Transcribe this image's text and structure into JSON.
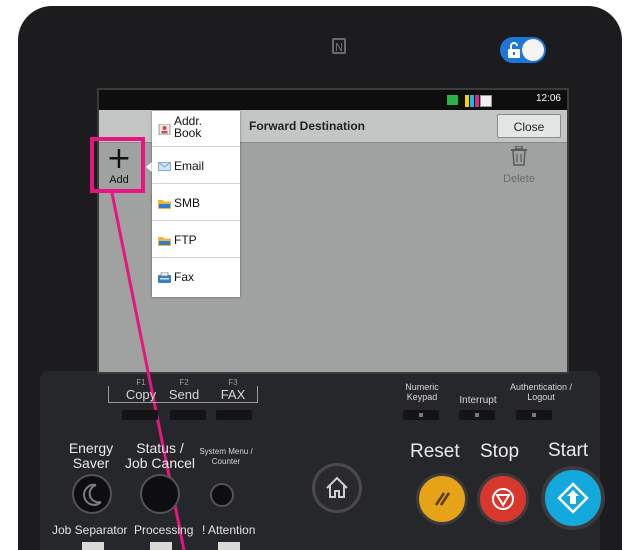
{
  "panel": {
    "nfc_icon": "nfc-icon",
    "lock_icon": "unlock-icon",
    "lock_toggle_color": "#1f76d8"
  },
  "screen": {
    "status": {
      "time": "12:06",
      "toner_colors": [
        "#f5d400",
        "#1eb4e6",
        "#d6278f",
        "#222222"
      ]
    },
    "title": "Forward Destination",
    "close_label": "Close",
    "add_label": "Add",
    "delete_label": "Delete",
    "hidden_fragment": "D",
    "menu": [
      {
        "label": "Addr.\nBook",
        "icon": "address-book-icon"
      },
      {
        "label": "Email",
        "icon": "email-icon"
      },
      {
        "label": "SMB",
        "icon": "smb-folder-icon"
      },
      {
        "label": "FTP",
        "icon": "ftp-folder-icon"
      },
      {
        "label": "Fax",
        "icon": "fax-icon"
      }
    ]
  },
  "function_keys": [
    {
      "num": "F1",
      "label": "Copy"
    },
    {
      "num": "F2",
      "label": "Send"
    },
    {
      "num": "F3",
      "label": "FAX"
    }
  ],
  "right_keys": {
    "numeric_keypad": "Numeric\nKeypad",
    "interrupt": "Interrupt",
    "authentication": "Authentication /\nLogout"
  },
  "round_keys": {
    "energy_saver": "Energy\nSaver",
    "status_job_cancel": "Status /\nJob Cancel",
    "system_menu": "System Menu /\nCounter",
    "reset": "Reset",
    "stop": "Stop",
    "start": "Start"
  },
  "bottom_labels": {
    "job_separator": "Job Separator",
    "processing": "Processing",
    "attention": "! Attention"
  },
  "colors": {
    "highlight": "#e6157f",
    "reset": "#e6a317",
    "stop": "#d8372e",
    "start": "#13a9dc"
  }
}
